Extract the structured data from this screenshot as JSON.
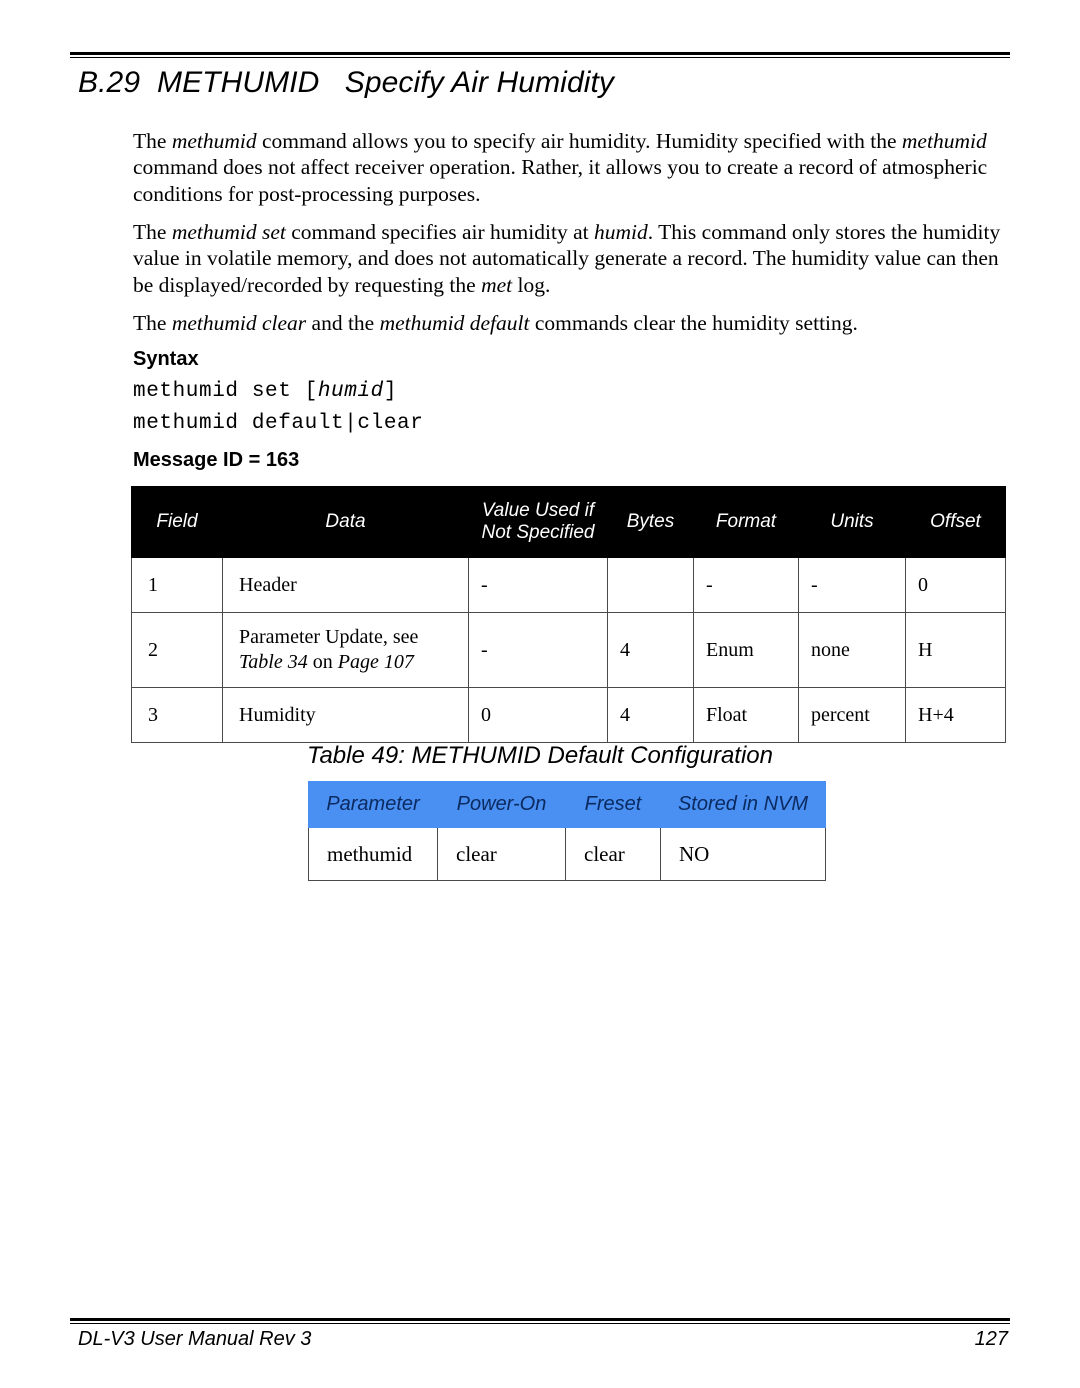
{
  "page": {
    "section_number": "B.29",
    "section_title": "B.29  METHUMID   Specify Air Humidity",
    "footer_left": "DL-V3 User Manual Rev 3",
    "footer_page_number": "127"
  },
  "paragraphs": {
    "p1_a": "The ",
    "p1_i1": "methumid",
    "p1_b": " command allows you to specify air humidity. Humidity specified with the ",
    "p1_i2": "methumid",
    "p1_c": " command does not affect receiver operation. Rather, it allows you to create a record of atmospheric conditions for post-processing purposes.",
    "p2_a": "The ",
    "p2_i1": "methumid set",
    "p2_b": " command specifies air humidity at ",
    "p2_i2": "humid",
    "p2_c": ". This command only stores the humidity value in volatile memory, and does not automatically generate a record. The humidity value can then be displayed/recorded by requesting the ",
    "p2_i3": "met",
    "p2_d": " log.",
    "p3_a": "The ",
    "p3_i1": "methumid clear",
    "p3_b": " and the ",
    "p3_i2": "methumid default",
    "p3_c": " commands clear the humidity setting."
  },
  "headings": {
    "syntax": "Syntax",
    "message_id": "Message ID = 163"
  },
  "syntax": {
    "line1_a": "methumid set [",
    "line1_i": "humid",
    "line1_b": "]",
    "line2": "methumid default|clear"
  },
  "message_table": {
    "columns": [
      "Field",
      "Data",
      "Value Used if\nNot Specified",
      "Bytes",
      "Format",
      "Units",
      "Offset"
    ],
    "col_field": "Field",
    "col_data": "Data",
    "col_value_line1": "Value Used if",
    "col_value_line2": "Not Specified",
    "col_bytes": "Bytes",
    "col_format": "Format",
    "col_units": "Units",
    "col_offset": "Offset",
    "rows": [
      {
        "field": "1",
        "data": "Header",
        "data_ref_prefix": "",
        "data_ref_table": "",
        "data_ref_mid": "",
        "data_ref_page": "",
        "value_used": "-",
        "bytes": "",
        "format": "-",
        "units": "-",
        "offset": "0"
      },
      {
        "field": "2",
        "data": "Parameter Update, see",
        "data_ref_table": "Table 34",
        "data_ref_mid": " on ",
        "data_ref_page": "Page 107",
        "value_used": "-",
        "bytes": "4",
        "format": "Enum",
        "units": "none",
        "offset": "H"
      },
      {
        "field": "3",
        "data": "Humidity",
        "value_used": "0",
        "bytes": "4",
        "format": "Float",
        "units": "percent",
        "offset": "H+4"
      }
    ]
  },
  "config_table": {
    "caption": "Table 49: METHUMID Default Configuration",
    "columns": [
      "Parameter",
      "Power-On",
      "Freset",
      "Stored in NVM"
    ],
    "col_parameter": "Parameter",
    "col_power_on": "Power-On",
    "col_freset": "Freset",
    "col_stored_nvm": "Stored in NVM",
    "rows": [
      {
        "parameter": "methumid",
        "power_on": "clear",
        "freset": "clear",
        "stored_in_nvm": "NO"
      }
    ]
  },
  "colors": {
    "header_black": "#000000",
    "header_blue": "#4a90f2",
    "header_blue_text": "#0b2a60",
    "text": "#000000",
    "border": "#4a4a4a"
  }
}
